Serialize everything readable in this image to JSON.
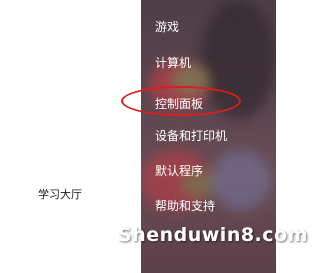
{
  "left_pane": {
    "recent_item": "学习大厅"
  },
  "start_menu_right": {
    "items": [
      "游戏",
      "计算机",
      "控制面板",
      "设备和打印机",
      "默认程序",
      "帮助和支持"
    ]
  },
  "annotation": {
    "highlight_color": "#d81e1e",
    "highlighted_item": "控制面板"
  },
  "watermark": {
    "text": "Shenduwin8.com"
  }
}
